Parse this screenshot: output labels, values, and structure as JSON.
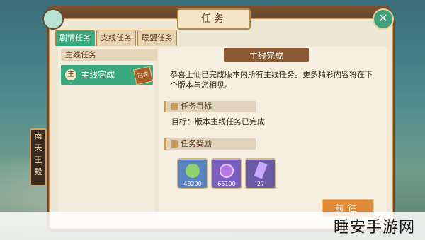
{
  "window": {
    "title": "任务"
  },
  "side_sign": {
    "chars": [
      "南",
      "天",
      "王",
      "殿"
    ]
  },
  "tabs": [
    {
      "label": "剧情任务",
      "active": true
    },
    {
      "label": "支线任务",
      "active": false
    },
    {
      "label": "联盟任务",
      "active": false
    }
  ],
  "left": {
    "category_label": "主线任务",
    "quest_tag": "主",
    "quest_name": "主线完成",
    "stamp": "已完成"
  },
  "detail": {
    "header": "主线完成",
    "description": "恭喜上仙已完成版本内所有主线任务。更多精彩内容将在下个版本与您相见。",
    "goal_title": "任务目标",
    "goal_text": "目标：版本主线任务已完成",
    "reward_title": "任务奖励",
    "rewards": [
      {
        "amount": "48200",
        "icon": "exp-orb-icon",
        "color": "#5b83c4"
      },
      {
        "amount": "65100",
        "icon": "spiral-orb-icon",
        "color": "#7a5fc2"
      },
      {
        "amount": "27",
        "icon": "crystal-icon",
        "color": "#6b5aa6"
      }
    ],
    "go_button": "前往"
  },
  "watermark": "睡安手游网"
}
